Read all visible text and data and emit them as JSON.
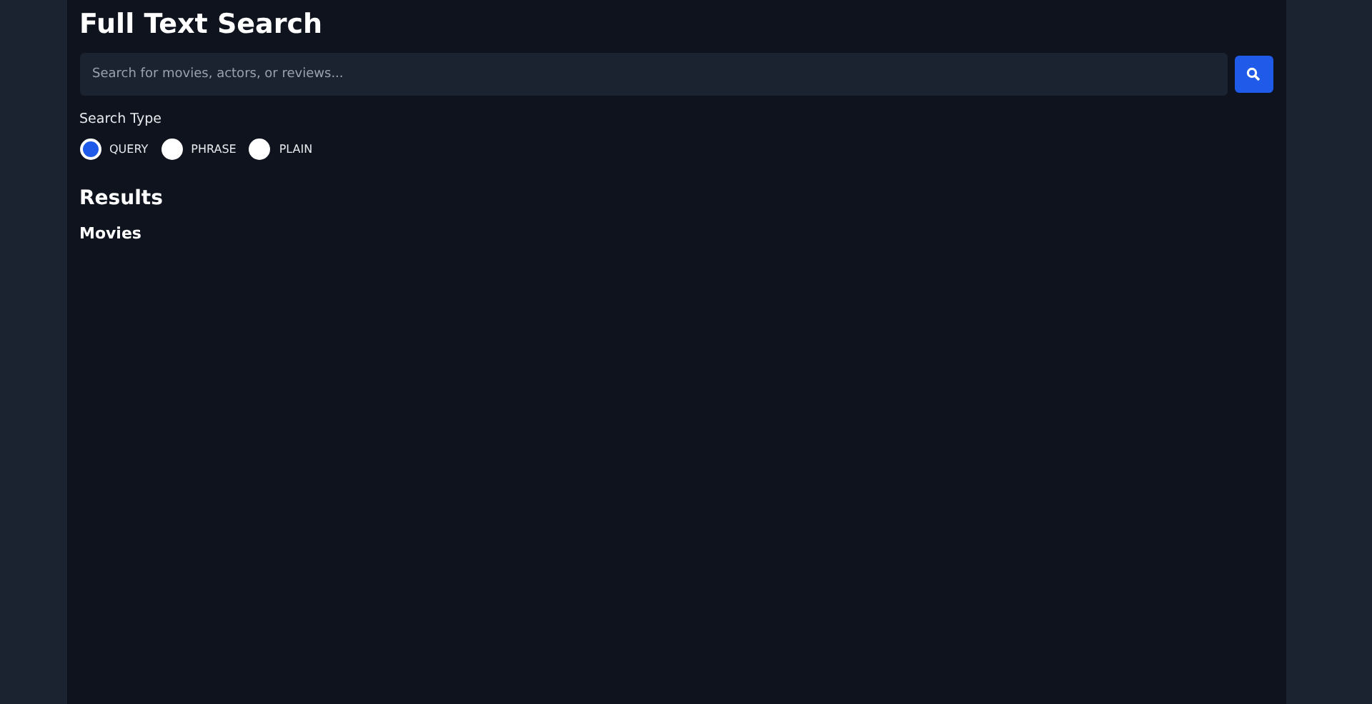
{
  "title": "Full Text Search",
  "search": {
    "placeholder": "Search for movies, actors, or reviews..."
  },
  "search_type": {
    "label": "Search Type",
    "options": [
      {
        "label": "QUERY",
        "selected": true
      },
      {
        "label": "PHRASE",
        "selected": false
      },
      {
        "label": "PLAIN",
        "selected": false
      }
    ]
  },
  "results": {
    "heading": "Results",
    "sections": [
      "Movies"
    ]
  }
}
